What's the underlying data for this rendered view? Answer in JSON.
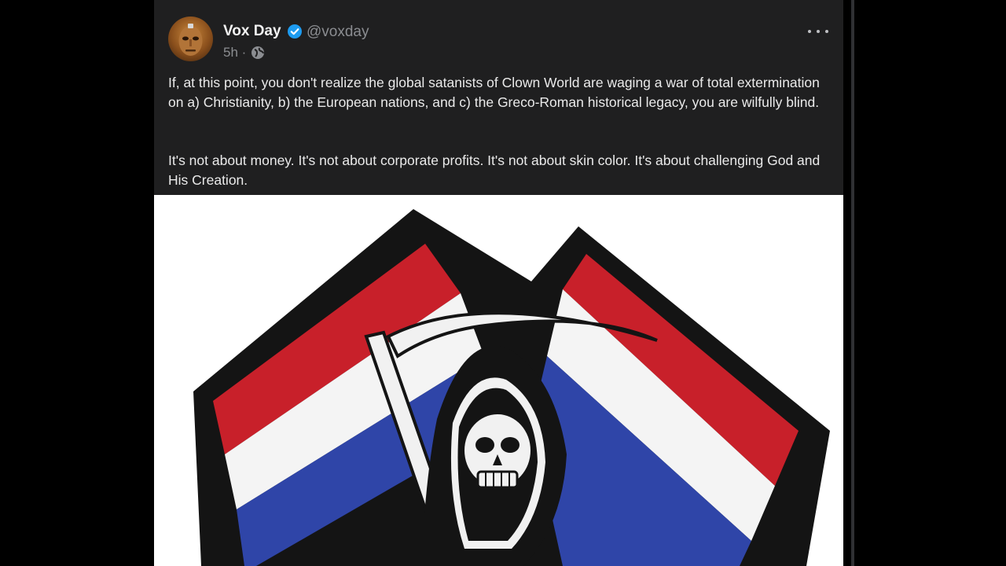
{
  "post": {
    "author_name": "Vox Day",
    "handle": "@voxday",
    "time": "5h",
    "separator": "·",
    "paragraph1": "If, at this point, you don't realize the global satanists of Clown World are waging a war of total extermination on a) Christianity, b) the European nations, and c) the Greco-Roman historical legacy, you are wilfully blind.",
    "paragraph2": "It's not about money. It's not about corporate profits. It's not about skin color. It's about challenging God and His Creation."
  },
  "icons": {
    "verified": "verified-badge-icon",
    "globe": "globe-icon",
    "more": "more-options-icon"
  },
  "colors": {
    "background": "#000000",
    "post_background": "#1f1f20",
    "text": "#eaeaea",
    "muted": "#8b8d91",
    "verified_blue": "#1d9bf0",
    "flag_red": "#c8202a",
    "flag_white": "#f4f4f4",
    "flag_blue": "#2f45a8"
  }
}
